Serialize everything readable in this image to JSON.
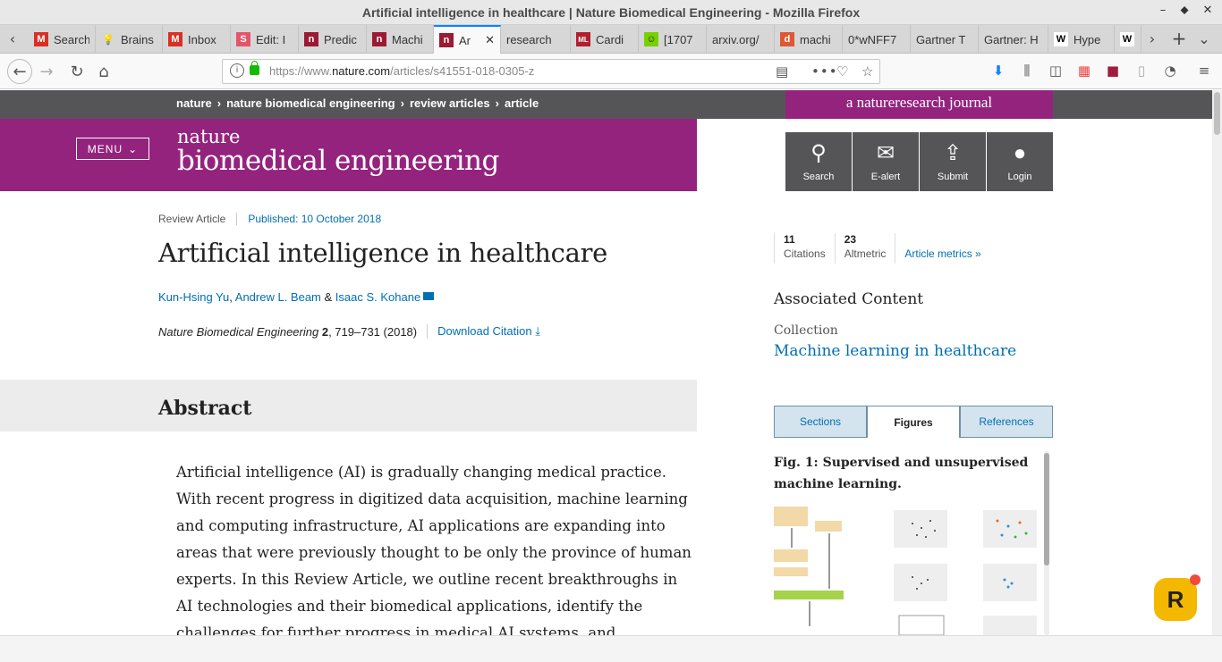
{
  "window": {
    "title": "Artificial intelligence in healthcare | Nature Biomedical Engineering - Mozilla Firefox"
  },
  "tabs": [
    {
      "label": "Search",
      "icon": "gmail-icon"
    },
    {
      "label": "Brains",
      "icon": "bulb-icon"
    },
    {
      "label": "Inbox",
      "icon": "gmail-icon"
    },
    {
      "label": "Edit: I",
      "icon": "s-icon"
    },
    {
      "label": "Predic",
      "icon": "nature-icon"
    },
    {
      "label": "Machi",
      "icon": "nature-icon"
    },
    {
      "label": "Ar",
      "icon": "nature-icon",
      "active": true
    },
    {
      "label": "research",
      "icon": ""
    },
    {
      "label": "Cardi",
      "icon": "ml-icon"
    },
    {
      "label": "[1707",
      "icon": "smiley-icon"
    },
    {
      "label": "arxiv.org/",
      "icon": ""
    },
    {
      "label": "machi",
      "icon": "duckduckgo-icon"
    },
    {
      "label": "0*wNFF7",
      "icon": ""
    },
    {
      "label": "Gartner T",
      "icon": ""
    },
    {
      "label": "Gartner: H",
      "icon": ""
    },
    {
      "label": "Hype",
      "icon": "wikipedia-icon"
    },
    {
      "label": "",
      "icon": "wikipedia-icon"
    }
  ],
  "nav": {
    "url_prefix": "https://www.",
    "url_domain": "nature.com",
    "url_path": "/articles/s41551-018-0305-z"
  },
  "page": {
    "breadcrumb": [
      "nature",
      "nature biomedical engineering",
      "review articles",
      "article"
    ],
    "journal_tag": "a natureresearch journal",
    "menu_label": "MENU",
    "logo_line1": "nature",
    "logo_line2": "biomedical engineering",
    "tools": [
      {
        "label": "Search",
        "icon": "search-icon"
      },
      {
        "label": "E-alert",
        "icon": "mail-icon"
      },
      {
        "label": "Submit",
        "icon": "upload-icon"
      },
      {
        "label": "Login",
        "icon": "user-icon"
      }
    ],
    "article_type": "Review Article",
    "published": "Published: 10 October 2018",
    "title": "Artificial intelligence in healthcare",
    "authors": [
      "Kun-Hsing Yu",
      "Andrew L. Beam",
      "Isaac S. Kohane"
    ],
    "author_sep1": ", ",
    "author_sep2": " & ",
    "citation_journal": "Nature Biomedical Engineering",
    "citation_volume": "2",
    "citation_pages": ", 719–731 (2018)",
    "download_citation": "Download Citation",
    "abstract_heading": "Abstract",
    "abstract_text": "Artificial intelligence (AI) is gradually changing medical practice. With recent progress in digitized data acquisition, machine learning and computing infrastructure, AI applications are expanding into areas that were previously thought to be only the province of human experts. In this Review Article, we outline recent breakthroughs in AI technologies and their biomedical applications, identify the challenges for further progress in medical AI systems, and summarize the economic, legal and",
    "metrics": {
      "citations_count": "11",
      "citations_label": "Citations",
      "altmetric_count": "23",
      "altmetric_label": "Altmetric",
      "article_metrics": "Article metrics"
    },
    "associated_content": "Associated Content",
    "collection_label": "Collection",
    "collection_link": "Machine learning in healthcare",
    "panel_tabs": [
      "Sections",
      "Figures",
      "References"
    ],
    "panel_selected": "Figures",
    "figure_caption": "Fig. 1: Supervised and unsupervised machine learning."
  },
  "colors": {
    "brand": "#94237e",
    "bar": "#555557",
    "link": "#006fb3"
  }
}
